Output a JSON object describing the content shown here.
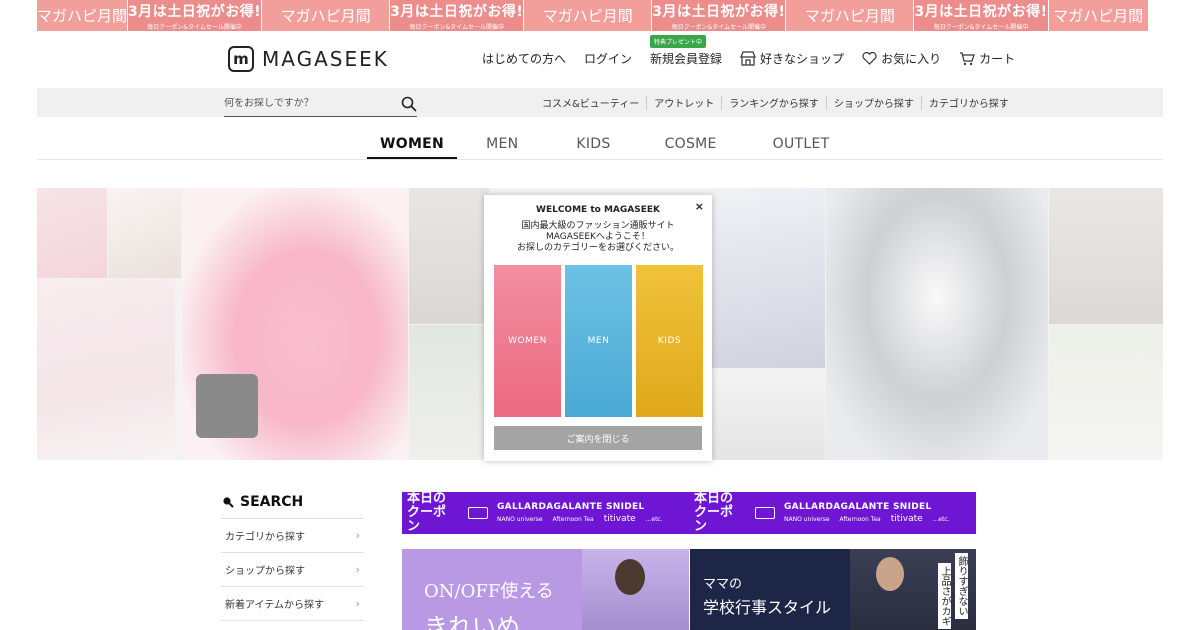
{
  "promo": {
    "main": "3月は土日祝がお得!",
    "sub": "毎日クーポン&タイムセール開催中",
    "hapi": "マガハピ月間"
  },
  "header": {
    "logo_text": "MAGASEEK",
    "nav": {
      "first_time": "はじめての方へ",
      "login": "ログイン",
      "badge": "特典プレゼント中",
      "signup": "新規会員登録",
      "fav_shop": "好きなショップ",
      "favorites": "お気に入り",
      "cart": "カート"
    }
  },
  "search": {
    "placeholder": "何をお探しですか？"
  },
  "sub_nav": [
    "コスメ&ビューティー",
    "アウトレット",
    "ランキングから探す",
    "ショップから探す",
    "カテゴリから探す"
  ],
  "tabs": [
    "WOMEN",
    "MEN",
    "KIDS",
    "COSME",
    "OUTLET"
  ],
  "modal": {
    "title": "WELCOME to MAGASEEK",
    "line1": "国内最大級のファッション通販サイト",
    "line2": "MAGASEEKへようこそ！",
    "line3": "お探しのカテゴリーをお選びください。",
    "cards": [
      "WOMEN",
      "MEN",
      "KIDS"
    ],
    "close_button": "ご案内を閉じる",
    "close_icon": "×"
  },
  "sidebar": {
    "title": "SEARCH",
    "items": [
      "カテゴリから探す",
      "ショップから探す",
      "新着アイテムから探す"
    ]
  },
  "coupon_banner": {
    "today": "本日の",
    "coupon": "クーポン",
    "brands_row1": "GALLARDAGALANTE  SNIDEL",
    "brand_nano": "NANO universe",
    "brand_afternoon": "Afternoon Tea",
    "brand_titivate": "titivate",
    "etc": "...etc."
  },
  "features": {
    "a_line1": "ON/OFF使える",
    "a_line2": "きれいめ",
    "b_line1": "ママの",
    "b_line2": "学校行事スタイル",
    "b_vert1": "飾りすぎない",
    "b_vert2": "上品さがカギ"
  },
  "colors": {
    "promo": "#ec8d8b",
    "badge": "#3aa64a",
    "coupon": "#6e16d4",
    "women_card": "#ee6f85",
    "men_card": "#56b5dc",
    "kids_card": "#e8b224"
  }
}
